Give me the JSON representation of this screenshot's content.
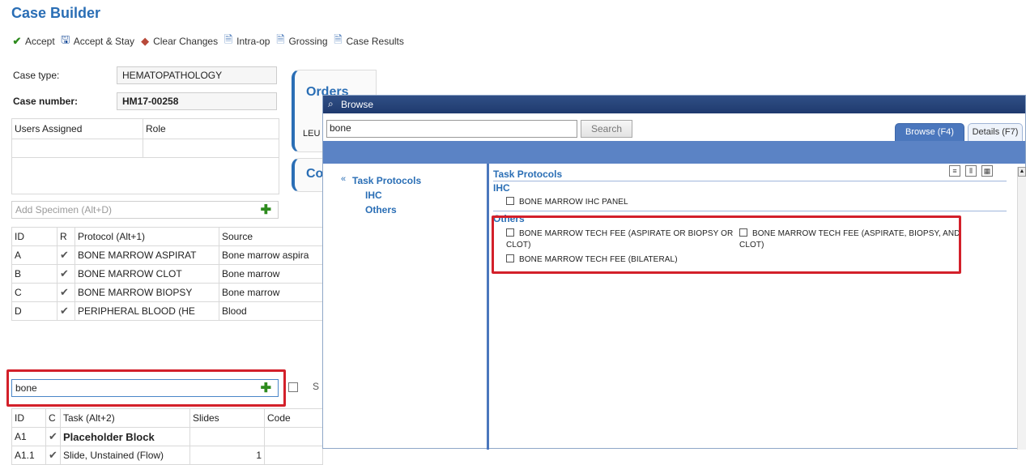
{
  "app": {
    "title": "Case Builder"
  },
  "toolbar": {
    "items": [
      {
        "label": "Accept",
        "icon": "checkmark-icon"
      },
      {
        "label": "Accept & Stay",
        "icon": "save-icon"
      },
      {
        "label": "Clear Changes",
        "icon": "eraser-icon"
      },
      {
        "label": "Intra-op",
        "icon": "page-arrow-icon"
      },
      {
        "label": "Grossing",
        "icon": "page-arrow-icon"
      },
      {
        "label": "Case Results",
        "icon": "page-arrow-icon"
      }
    ]
  },
  "case": {
    "type_label": "Case type:",
    "type_value": "HEMATOPATHOLOGY",
    "number_label": "Case number:",
    "number_value": "HM17-00258"
  },
  "users": {
    "col_users": "Users Assigned",
    "col_role": "Role"
  },
  "specimen": {
    "add_placeholder": "Add Specimen (Alt+D)",
    "columns": [
      "ID",
      "R",
      "Protocol (Alt+1)",
      "Source"
    ],
    "rows": [
      {
        "id": "A",
        "protocol": "BONE MARROW ASPIRAT",
        "source": "Bone marrow aspira"
      },
      {
        "id": "B",
        "protocol": "BONE MARROW CLOT",
        "source": "Bone marrow"
      },
      {
        "id": "C",
        "protocol": "BONE MARROW BIOPSY",
        "source": "Bone marrow"
      },
      {
        "id": "D",
        "protocol": "PERIPHERAL BLOOD (HE",
        "source": "Blood"
      }
    ]
  },
  "task": {
    "search_value": "bone",
    "side_label": "S",
    "columns": [
      "ID",
      "C",
      "Task (Alt+2)",
      "Slides",
      "Code"
    ],
    "rows": [
      {
        "id": "A1",
        "task": "Placeholder Block",
        "slides": ""
      },
      {
        "id": "A1.1",
        "task": "Slide, Unstained (Flow)",
        "slides": "1"
      }
    ]
  },
  "orders": {
    "title": "Orders",
    "row_stub": "LEU",
    "second_title": "Co"
  },
  "browse": {
    "title": "Browse",
    "search_value": "bone",
    "search_button": "Search",
    "tab_browse": "Browse (F4)",
    "tab_details": "Details (F7)",
    "nav": {
      "section": "Task Protocols",
      "items": [
        "IHC",
        "Others"
      ]
    },
    "content": {
      "header": "Task Protocols",
      "groups": [
        {
          "name": "IHC",
          "items": [
            "BONE MARROW IHC PANEL"
          ]
        },
        {
          "name": "Others",
          "items": [
            "BONE MARROW TECH FEE (ASPIRATE OR BIOPSY OR CLOT)",
            "BONE MARROW TECH FEE (ASPIRATE, BIOPSY, AND CLOT)",
            "BONE MARROW TECH FEE (BILATERAL)"
          ]
        }
      ]
    }
  },
  "colors": {
    "accent": "#2a6eb5",
    "highlight": "#d3202a",
    "band": "#5b83c5"
  }
}
